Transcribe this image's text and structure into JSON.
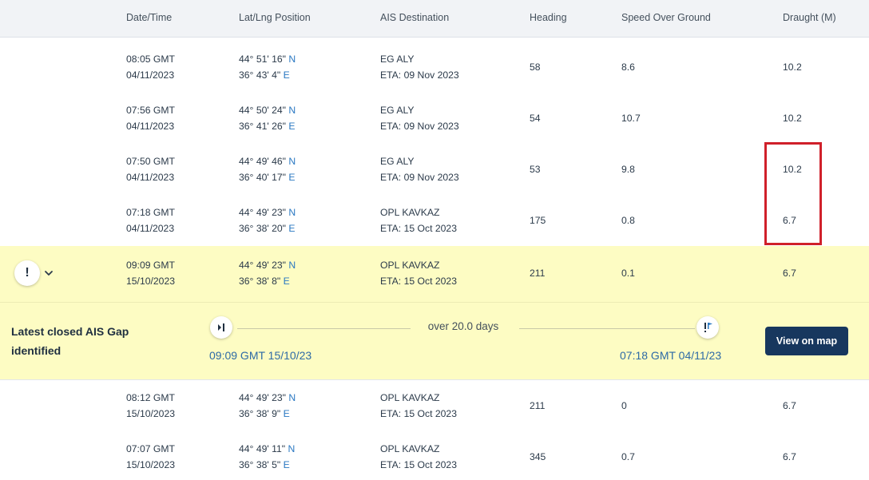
{
  "header": {
    "datetime": "Date/Time",
    "position": "Lat/Lng Position",
    "destination": "AIS Destination",
    "heading": "Heading",
    "sog": "Speed Over Ground",
    "draught": "Draught (M)"
  },
  "rows": [
    {
      "time": "08:05 GMT",
      "date": "04/11/2023",
      "lat": "44° 51' 16\"",
      "lat_dir": "N",
      "lng": "36° 43' 4\"",
      "lng_dir": "E",
      "dest": "EG ALY",
      "eta": "ETA: 09 Nov 2023",
      "heading": "58",
      "sog": "8.6",
      "draught": "10.2"
    },
    {
      "time": "07:56 GMT",
      "date": "04/11/2023",
      "lat": "44° 50' 24\"",
      "lat_dir": "N",
      "lng": "36° 41' 26\"",
      "lng_dir": "E",
      "dest": "EG ALY",
      "eta": "ETA: 09 Nov 2023",
      "heading": "54",
      "sog": "10.7",
      "draught": "10.2"
    },
    {
      "time": "07:50 GMT",
      "date": "04/11/2023",
      "lat": "44° 49' 46\"",
      "lat_dir": "N",
      "lng": "36° 40' 17\"",
      "lng_dir": "E",
      "dest": "EG ALY",
      "eta": "ETA: 09 Nov 2023",
      "heading": "53",
      "sog": "9.8",
      "draught": "10.2"
    },
    {
      "time": "07:18 GMT",
      "date": "04/11/2023",
      "lat": "44° 49' 23\"",
      "lat_dir": "N",
      "lng": "36° 38' 20\"",
      "lng_dir": "E",
      "dest": "OPL KAVKAZ",
      "eta": "ETA: 15 Oct 2023",
      "heading": "175",
      "sog": "0.8",
      "draught": "6.7"
    },
    {
      "time": "09:09 GMT",
      "date": "15/10/2023",
      "lat": "44° 49' 23\"",
      "lat_dir": "N",
      "lng": "36° 38' 8\"",
      "lng_dir": "E",
      "dest": "OPL KAVKAZ",
      "eta": "ETA: 15 Oct 2023",
      "heading": "211",
      "sog": "0.1",
      "draught": "6.7"
    },
    {
      "time": "08:12 GMT",
      "date": "15/10/2023",
      "lat": "44° 49' 23\"",
      "lat_dir": "N",
      "lng": "36° 38' 9\"",
      "lng_dir": "E",
      "dest": "OPL KAVKAZ",
      "eta": "ETA: 15 Oct 2023",
      "heading": "211",
      "sog": "0",
      "draught": "6.7"
    },
    {
      "time": "07:07 GMT",
      "date": "15/10/2023",
      "lat": "44° 49' 11\"",
      "lat_dir": "N",
      "lng": "36° 38' 5\"",
      "lng_dir": "E",
      "dest": "OPL KAVKAZ",
      "eta": "ETA: 15 Oct 2023",
      "heading": "345",
      "sog": "0.7",
      "draught": "6.7"
    }
  ],
  "alert_row": {
    "badge": "!",
    "icon": "alert-icon",
    "expand_icon": "chevron-down-icon"
  },
  "gap": {
    "title": "Latest closed AIS Gap identified",
    "duration": "over 20.0 days",
    "start_time": "09:09 GMT 15/10/23",
    "end_time": "07:18 GMT 04/11/23",
    "start_icon": "gap-start-icon",
    "end_icon": "gap-end-icon",
    "button": "View on map"
  },
  "colors": {
    "accent": "#17375e",
    "highlight": "#fdfcc3",
    "direction": "#2a78c2",
    "annotation": "#d0202a"
  }
}
